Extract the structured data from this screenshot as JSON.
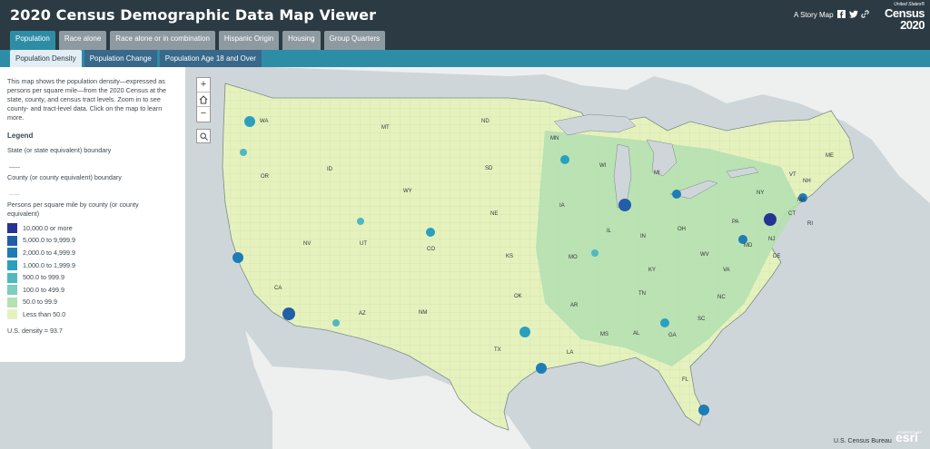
{
  "header": {
    "title": "2020 Census Demographic Data Map Viewer",
    "story_map": "A Story Map",
    "logo_line1": "United States®",
    "logo_line2": "Census",
    "logo_line3": "2020"
  },
  "main_tabs": [
    {
      "label": "Population",
      "active": true
    },
    {
      "label": "Race alone",
      "active": false
    },
    {
      "label": "Race alone or in combination",
      "active": false
    },
    {
      "label": "Hispanic Origin",
      "active": false
    },
    {
      "label": "Housing",
      "active": false
    },
    {
      "label": "Group Quarters",
      "active": false
    }
  ],
  "sub_tabs": [
    {
      "label": "Population Density",
      "active": true
    },
    {
      "label": "Population Change",
      "active": false
    },
    {
      "label": "Population Age 18 and Over",
      "active": false
    }
  ],
  "panel": {
    "intro": "This map shows the population density—expressed as persons per square mile—from the 2020 Census at the state, county, and census tract levels. Zoom in to see county- and tract-level data. Click on the map to learn more.",
    "legend_title": "Legend",
    "state_boundary": "State (or state equivalent) boundary",
    "county_boundary": "County (or county equivalent) boundary",
    "density_title": "Persons per square mile by county (or county equivalent)",
    "us_density": "U.S. density = 93.7"
  },
  "legend_classes": [
    {
      "label": "10,000.0 or more",
      "color": "#253494"
    },
    {
      "label": "5,000.0 to 9,999.9",
      "color": "#225ea8"
    },
    {
      "label": "2,000.0 to 4,999.9",
      "color": "#1d7db7"
    },
    {
      "label": "1,000.0 to 1,999.9",
      "color": "#2aa0c0"
    },
    {
      "label": "500.0 to 999.9",
      "color": "#4fb8c0"
    },
    {
      "label": "100.0 to 499.9",
      "color": "#7fcdbb"
    },
    {
      "label": "50.0 to 99.9",
      "color": "#b5e0b1"
    },
    {
      "label": "Less than 50.0",
      "color": "#e6f2be"
    }
  ],
  "map": {
    "state_labels": [
      "WA",
      "MT",
      "ND",
      "MN",
      "OR",
      "ID",
      "SD",
      "WI",
      "MI",
      "VT",
      "NH",
      "ME",
      "WY",
      "NY",
      "MA",
      "IA",
      "NE",
      "PA",
      "CT",
      "RI",
      "NV",
      "UT",
      "IL",
      "IN",
      "OH",
      "NJ",
      "CO",
      "KS",
      "MO",
      "WV",
      "MD",
      "DE",
      "KY",
      "VA",
      "CA",
      "TN",
      "NC",
      "OK",
      "AR",
      "AZ",
      "NM",
      "SC",
      "MS",
      "AL",
      "GA",
      "TX",
      "LA",
      "FL"
    ],
    "attribution": "U.S. Census Bureau",
    "esri_powered": "POWERED BY",
    "esri": "esri"
  },
  "colors": {
    "header_bg": "#2b3a43",
    "active_tab": "#2e8da6",
    "inactive_tab": "#8e9aa1",
    "subtab_bg": "#38688a",
    "land": "#e6f2be",
    "water": "#cfd6d9",
    "outside_land": "#eef0ef"
  },
  "icons": {
    "zoom_in": "plus-icon",
    "home": "home-icon",
    "zoom_out": "minus-icon",
    "search": "search-icon",
    "facebook": "facebook-icon",
    "twitter": "twitter-icon",
    "link": "link-icon"
  }
}
